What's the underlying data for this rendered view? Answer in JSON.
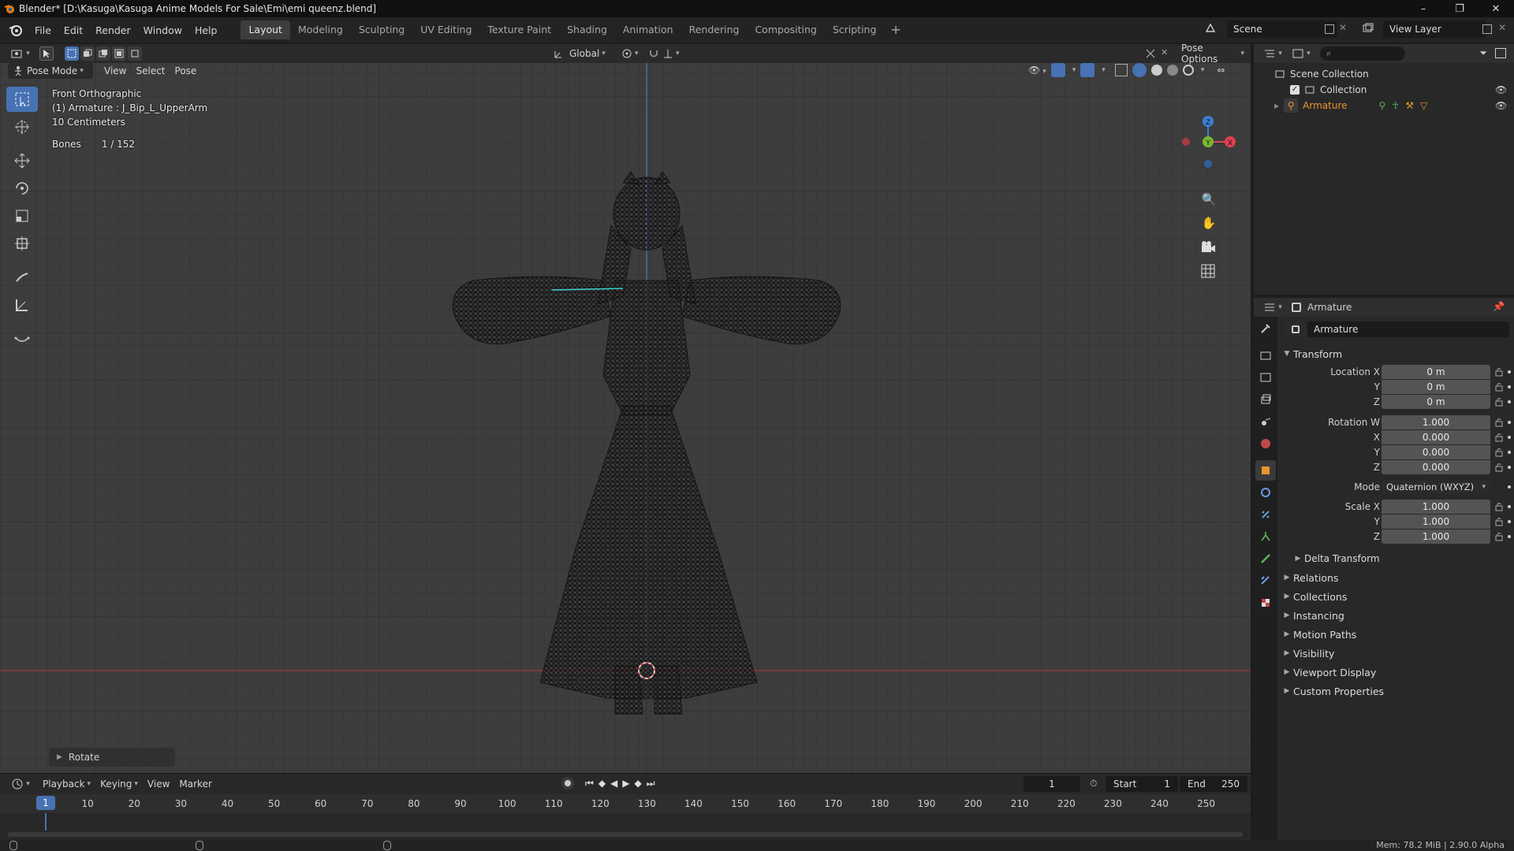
{
  "window": {
    "title": "Blender* [D:\\Kasuga\\Kasuga Anime Models For Sale\\Emi\\emi queenz.blend]",
    "controls": [
      "–",
      "❐",
      "✕"
    ]
  },
  "menubar": {
    "items": [
      "File",
      "Edit",
      "Render",
      "Window",
      "Help"
    ],
    "workspaces": [
      "Layout",
      "Modeling",
      "Sculpting",
      "UV Editing",
      "Texture Paint",
      "Shading",
      "Animation",
      "Rendering",
      "Compositing",
      "Scripting"
    ],
    "active_workspace": "Layout",
    "scene": "Scene",
    "view_layer": "View Layer"
  },
  "viewport": {
    "mode": "Pose Mode",
    "menus": [
      "View",
      "Select",
      "Pose"
    ],
    "transform_orientation": "Global",
    "pose_options": "Pose Options",
    "overlay": {
      "view_name": "Front Orthographic",
      "active": "(1) Armature : J_Bip_L_UpperArm",
      "scale": "10 Centimeters",
      "bones_label": "Bones",
      "bones_count": "1 / 152"
    },
    "gizmo_axes": {
      "z": "Z",
      "y": "Y",
      "x": "X"
    },
    "last_op_panel": "Rotate",
    "colors": {
      "accent": "#4772b3",
      "x_axis": "#e0404f",
      "y_axis": "#7ab730",
      "z_axis": "#3d7fd6"
    }
  },
  "timeline": {
    "menus": [
      "Playback",
      "Keying",
      "View",
      "Marker"
    ],
    "current_frame": "1",
    "start_label": "Start",
    "start": "1",
    "end_label": "End",
    "end": "250",
    "ruler_labels": [
      "1",
      "10",
      "20",
      "30",
      "40",
      "50",
      "60",
      "70",
      "80",
      "90",
      "100",
      "110",
      "120",
      "130",
      "140",
      "150",
      "160",
      "170",
      "180",
      "190",
      "200",
      "210",
      "220",
      "230",
      "240",
      "250"
    ]
  },
  "outliner": {
    "root": "Scene Collection",
    "collection": "Collection",
    "object": "Armature"
  },
  "properties": {
    "header_object": "Armature",
    "object_name": "Armature",
    "transform_label": "Transform",
    "location": {
      "label_x": "Location X",
      "label_y": "Y",
      "label_z": "Z",
      "x": "0 m",
      "y": "0 m",
      "z": "0 m"
    },
    "rotation": {
      "label_w": "Rotation W",
      "label_x": "X",
      "label_y": "Y",
      "label_z": "Z",
      "w": "1.000",
      "x": "0.000",
      "y": "0.000",
      "z": "0.000"
    },
    "mode_label": "Mode",
    "mode_value": "Quaternion (WXYZ)",
    "scale": {
      "label_x": "Scale X",
      "label_y": "Y",
      "label_z": "Z",
      "x": "1.000",
      "y": "1.000",
      "z": "1.000"
    },
    "delta_transform": "Delta Transform",
    "panels": [
      "Relations",
      "Collections",
      "Instancing",
      "Motion Paths",
      "Visibility",
      "Viewport Display",
      "Custom Properties"
    ]
  },
  "statusbar": {
    "memory": "Mem: 78.2 MiB | 2.90.0 Alpha"
  }
}
